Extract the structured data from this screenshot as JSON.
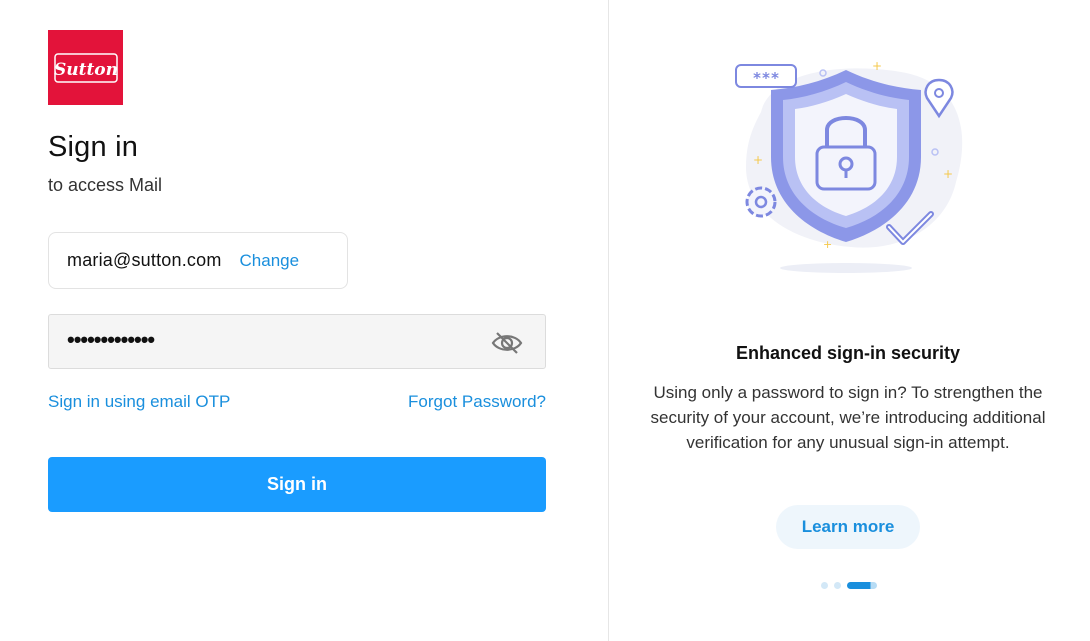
{
  "brand": {
    "logo_text": "Sutton",
    "color": "#e3133a"
  },
  "header": {
    "title": "Sign in",
    "subtitle": "to access Mail"
  },
  "account": {
    "email": "maria@sutton.com",
    "change_label": "Change"
  },
  "password": {
    "masked_value": "•••••••••••••",
    "toggle_icon": "eye-slash-icon"
  },
  "links": {
    "otp_label": "Sign in using email OTP",
    "forgot_label": "Forgot Password?"
  },
  "actions": {
    "signin_label": "Sign in"
  },
  "promo": {
    "heading": "Enhanced sign-in security",
    "body": "Using only a password to sign in? To strengthen the security of your account, we’re introducing additional verification for any unusual sign-in attempt.",
    "button_label": "Learn more",
    "password_hint": "***",
    "carousel": {
      "total": 3,
      "active": 3
    }
  },
  "colors": {
    "accent": "#1a9cff",
    "link": "#1a8fdd",
    "shield": "#8c97e8"
  }
}
